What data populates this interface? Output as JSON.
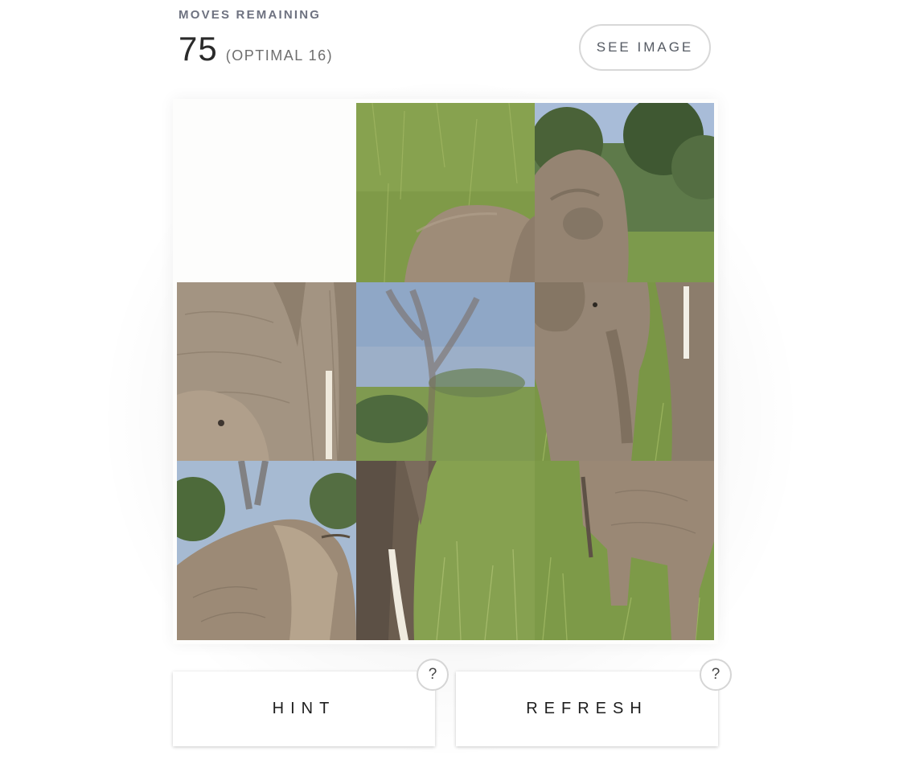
{
  "status": {
    "label": "MOVES REMAINING",
    "moves_remaining": "75",
    "optimal_prefix": "(OPTIMAL ",
    "optimal_moves": "16",
    "optimal_suffix": ")"
  },
  "see_image_label": "SEE IMAGE",
  "actions": {
    "hint_label": "HINT",
    "refresh_label": "REFRESH",
    "help_glyph": "?"
  },
  "puzzle": {
    "grid_size": 3,
    "empty_cell": "top-left",
    "tiles": [
      {
        "position": "r1c2",
        "content": "grass with baby elephant back"
      },
      {
        "position": "r1c3",
        "content": "elephant head and trees"
      },
      {
        "position": "r2c1",
        "content": "elephant body and calf"
      },
      {
        "position": "r2c2",
        "content": "blurred tree and sky"
      },
      {
        "position": "r2c3",
        "content": "young elephant and tusk"
      },
      {
        "position": "r3c1",
        "content": "elephant back with trees"
      },
      {
        "position": "r3c2",
        "content": "elephant trunk and tusk in grass"
      },
      {
        "position": "r3c3",
        "content": "elephant legs in grass"
      }
    ]
  },
  "colors": {
    "grass": "#7f9a48",
    "elephant": "#9a8a78",
    "sky": "#a9bfdc",
    "foliage": "#4e6a3e"
  }
}
